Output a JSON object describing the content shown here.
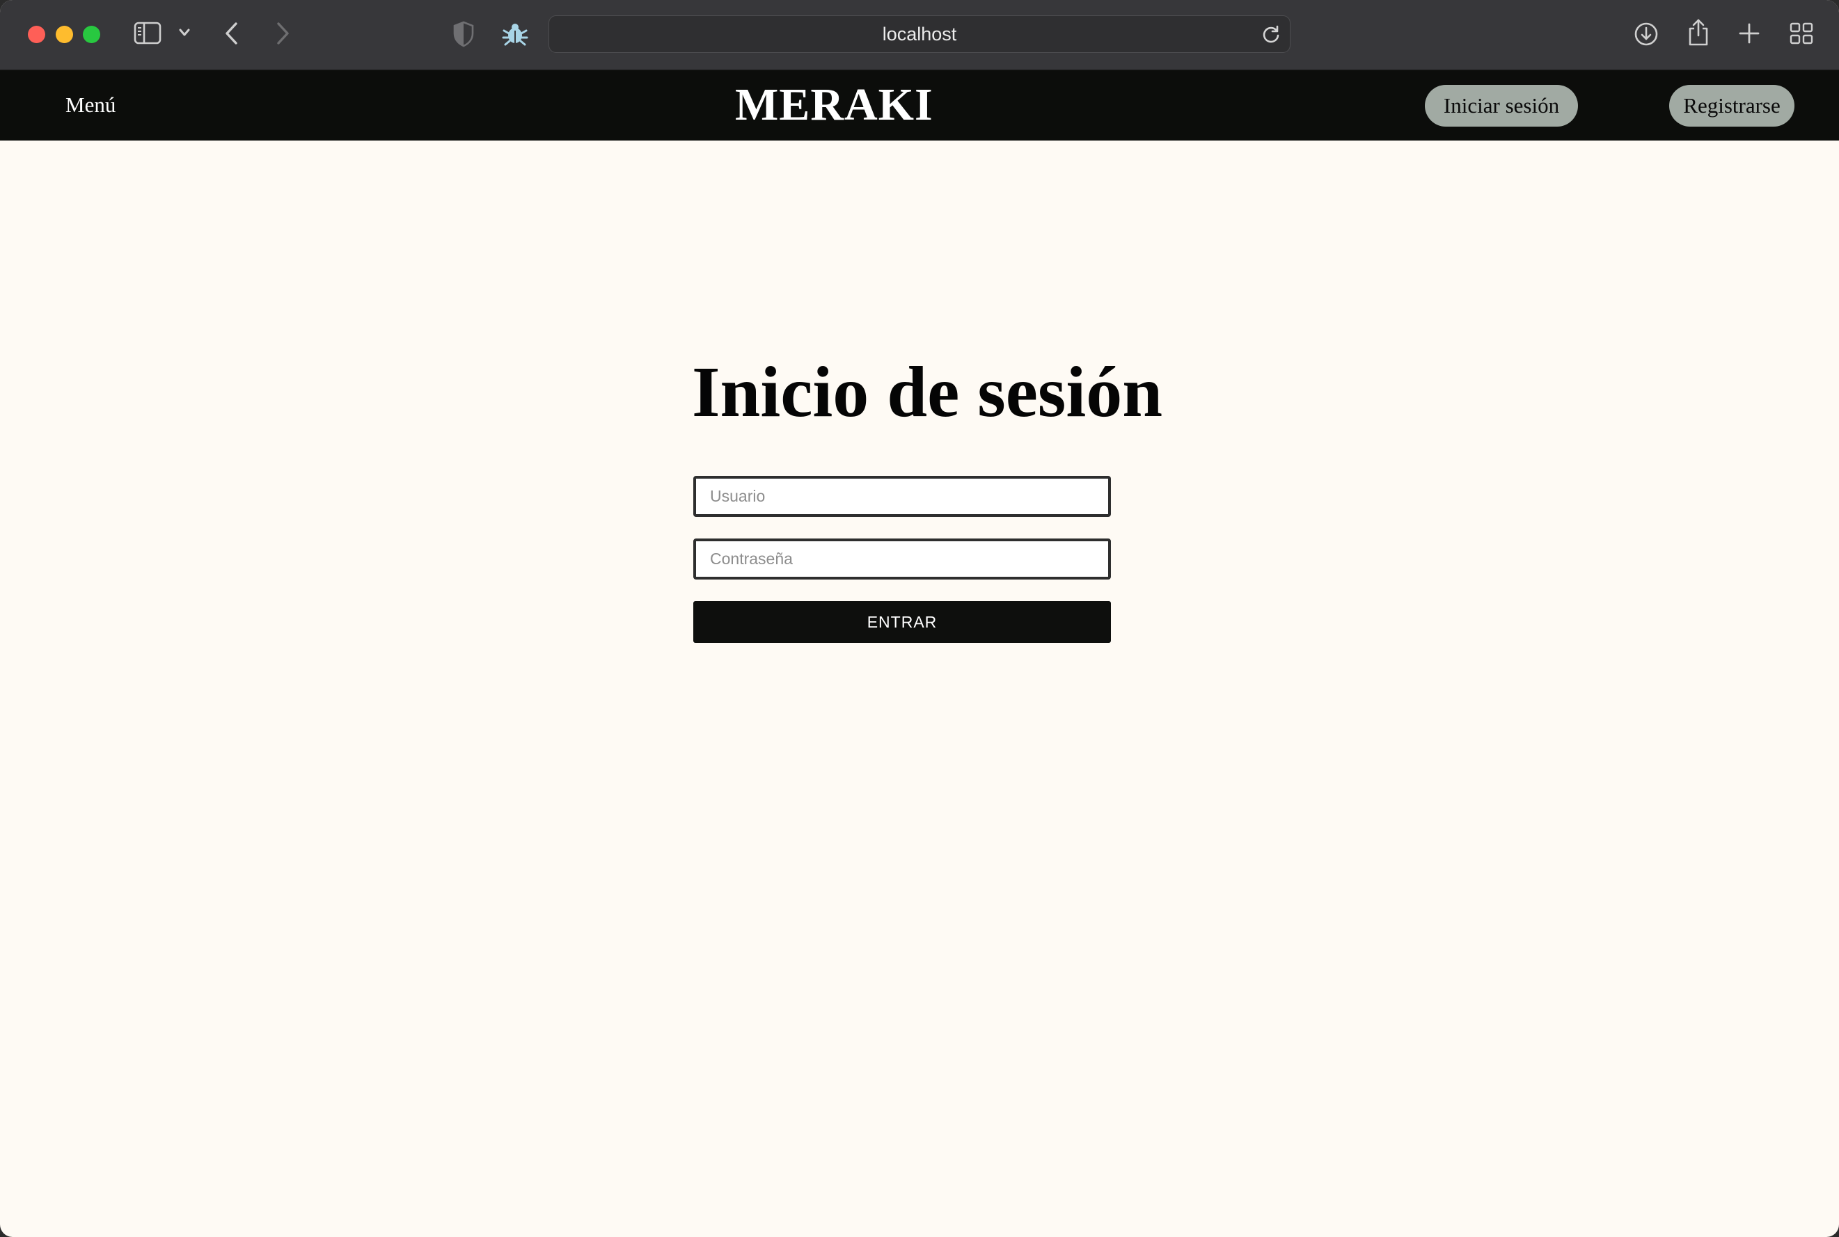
{
  "browser": {
    "url": "localhost",
    "icons": [
      "sidebar-icon",
      "chevron-down-icon",
      "back-icon",
      "forward-icon",
      "shield-icon",
      "bug-extension-icon",
      "reload-icon",
      "download-icon",
      "share-icon",
      "plus-icon",
      "tab-overview-icon"
    ]
  },
  "header": {
    "menu_label": "Menú",
    "brand": "MERAKI",
    "login_label": "Iniciar sesión",
    "signup_label": "Registrarse"
  },
  "main": {
    "title": "Inicio de sesión",
    "username_placeholder": "Usuario",
    "username_value": "",
    "password_placeholder": "Contraseña",
    "password_value": "",
    "submit_label": "ENTRAR"
  },
  "colors": {
    "page_background": "#fefaf4",
    "header_background": "#0c0d0b",
    "pill_background": "#a1aaa3",
    "button_background": "#0e0f0d",
    "toolbar_background": "#37373a"
  }
}
